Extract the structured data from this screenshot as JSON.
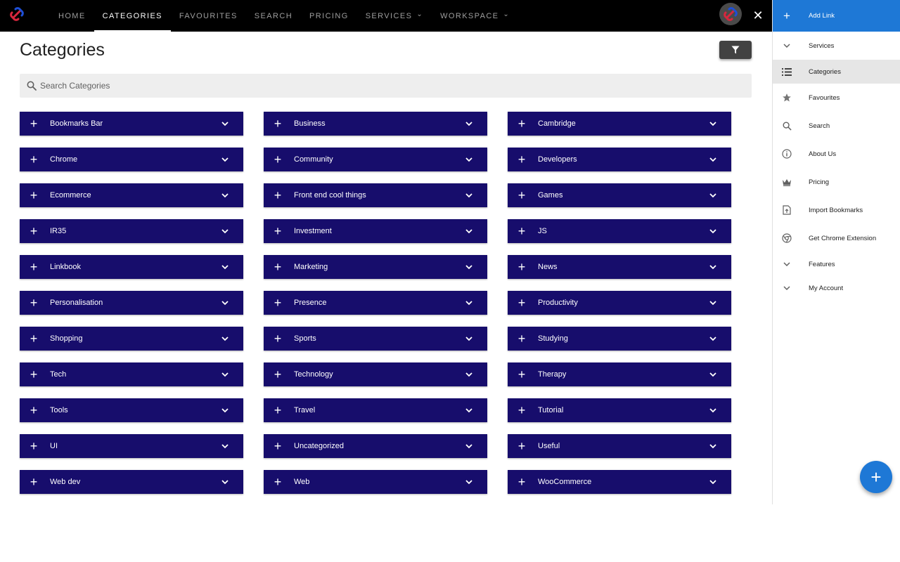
{
  "nav": {
    "items": [
      {
        "label": "HOME"
      },
      {
        "label": "CATEGORIES",
        "active": true
      },
      {
        "label": "FAVOURITES"
      },
      {
        "label": "SEARCH"
      },
      {
        "label": "PRICING"
      },
      {
        "label": "SERVICES",
        "dropdown": true
      },
      {
        "label": "WORKSPACE",
        "dropdown": true
      }
    ]
  },
  "page": {
    "title": "Categories",
    "search_placeholder": "Search Categories"
  },
  "categories": [
    "Bookmarks Bar",
    "Business",
    "Cambridge",
    "Chrome",
    "Community",
    "Developers",
    "Ecommerce",
    "Front end cool things",
    "Games",
    "IR35",
    "Investment",
    "JS",
    "Linkbook",
    "Marketing",
    "News",
    "Personalisation",
    "Presence",
    "Productivity",
    "Shopping",
    "Sports",
    "Studying",
    "Tech",
    "Technology",
    "Therapy",
    "Tools",
    "Travel",
    "Tutorial",
    "UI",
    "Uncategorized",
    "Useful",
    "Web dev",
    "Web",
    "WooCommerce"
  ],
  "drawer": {
    "add_link": "Add Link",
    "items": [
      {
        "label": "Services",
        "icon": "chevron-down-icon"
      },
      {
        "label": "Categories",
        "icon": "list-icon",
        "active": true
      },
      {
        "label": "Favourites",
        "icon": "star-icon"
      },
      {
        "label": "Search",
        "icon": "search-icon"
      },
      {
        "label": "About Us",
        "icon": "info-icon"
      },
      {
        "label": "Pricing",
        "icon": "crown-icon"
      },
      {
        "label": "Import Bookmarks",
        "icon": "file-upload-icon"
      },
      {
        "label": "Get Chrome Extension",
        "icon": "chrome-icon"
      },
      {
        "label": "Features",
        "icon": "chevron-down-icon"
      },
      {
        "label": "My Account",
        "icon": "chevron-down-icon"
      }
    ]
  },
  "colors": {
    "topbar": "#000000",
    "category_bar": "#170d6c",
    "accent": "#1e78d6"
  }
}
